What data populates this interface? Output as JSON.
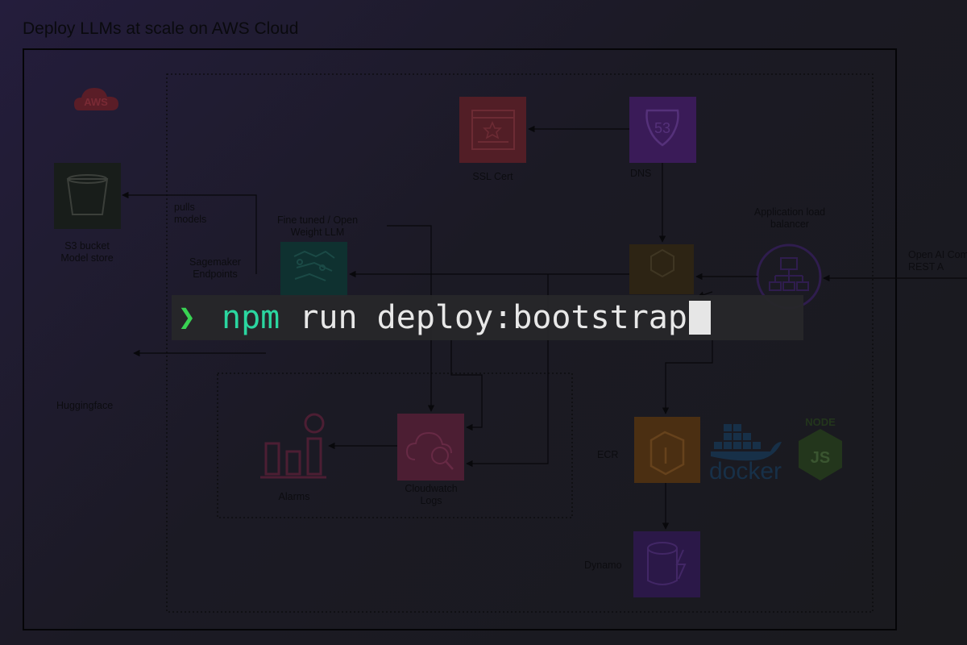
{
  "diagram": {
    "title": "Deploy LLMs at scale on AWS Cloud",
    "cloud_badge": "AWS",
    "nodes": {
      "s3": "S3 bucket\nModel store",
      "pulls": "pulls\nmodels",
      "sagemaker": "Sagemaker\nEndpoints",
      "finetuned": "Fine tuned / Open\nWeight LLM",
      "huggingface": "Huggingface",
      "ssl": "SSL Cert",
      "dns": "DNS",
      "dns_badge": "53",
      "alb": "Application load\nbalancer",
      "openai": "Open AI Com\nREST A",
      "ecr": "ECR",
      "docker": "docker",
      "node": "NODE",
      "node_js": "JS",
      "dynamo": "Dynamo",
      "alarms": "Alarms",
      "cloudwatch": "Cloudwatch\nLogs"
    }
  },
  "terminal": {
    "prompt": "❯",
    "command_npm": "npm",
    "command_rest": " run deploy:bootstrap"
  }
}
